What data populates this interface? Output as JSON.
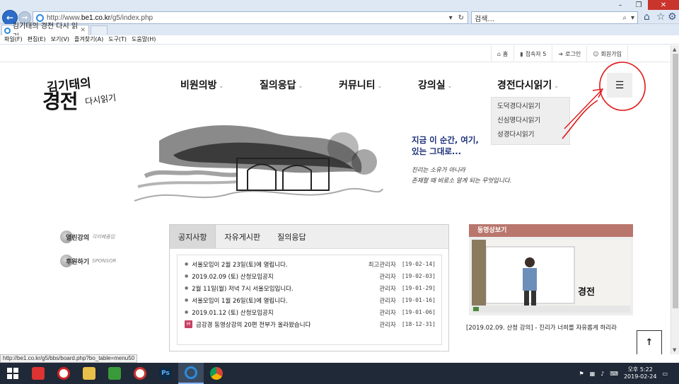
{
  "browser": {
    "url_prefix": "http://www.",
    "url_domain": "be1.co.kr",
    "url_path": "/g5/index.php",
    "search_placeholder": "검색...",
    "tab_title": "김기태의 경전 다시 읽기",
    "menu": [
      "파일(F)",
      "편집(E)",
      "보기(V)",
      "즐겨찾기(A)",
      "도구(T)",
      "도움말(H)"
    ],
    "status_url": "http://be1.co.kr/g5/bbs/board.php?bo_table=menu50"
  },
  "util_links": [
    {
      "icon": "home-icon",
      "glyph": "⌂",
      "label": "홈"
    },
    {
      "icon": "bar-chart-icon",
      "glyph": "▮",
      "label": "접속자 5"
    },
    {
      "icon": "login-icon",
      "glyph": "➜",
      "label": "로그인"
    },
    {
      "icon": "user-plus-icon",
      "glyph": "☺",
      "label": "회원가입"
    }
  ],
  "logo": {
    "line1": "김기태의",
    "line2": "경전",
    "line3": "다시읽기"
  },
  "nav": [
    {
      "label": "비원의방"
    },
    {
      "label": "질의응답"
    },
    {
      "label": "커뮤니티"
    },
    {
      "label": "강의실"
    },
    {
      "label": "경전다시읽기"
    }
  ],
  "dropdown": [
    "도덕경다시읽기",
    "신심명다시읽기",
    "성경다시읽기"
  ],
  "hero": {
    "headline_1": "지금 이 순간, 여기,",
    "headline_2": "있는 그대로...",
    "sub_1": "진리는 소유가 아니라",
    "sub_2": "존재할 때 비로소 알게 되는 무엇입니다."
  },
  "side_links": [
    {
      "label": "열린강의",
      "sub": "각리베줌입"
    },
    {
      "label": "후원하기",
      "sub": "SPONSOR"
    }
  ],
  "board": {
    "tabs": [
      "공지사항",
      "자유게시판",
      "질의응답"
    ],
    "posts": [
      {
        "title": "서울모임이 2월 23일(토)에 열립니다.",
        "author": "최고관리자",
        "date": "[19-02-14]"
      },
      {
        "title": "2019.02.09 (토) 산청모임공지",
        "author": "관리자",
        "date": "[19-02-03]"
      },
      {
        "title": "2월 11일(월) 저녁 7시 서울모임입니다.",
        "author": "관리자",
        "date": "[19-01-29]"
      },
      {
        "title": "서울모임이 1월 26일(토)에 열립니다.",
        "author": "관리자",
        "date": "[19-01-16]"
      },
      {
        "title": "2019.01.12 (토) 산청모임공지",
        "author": "관리자",
        "date": "[19-01-06]"
      },
      {
        "title": "금강경 동영상강의 20편 전부가 올라왔습니다",
        "author": "관리자",
        "date": "[18-12-31]",
        "badge": "H"
      }
    ]
  },
  "video": {
    "heading": "동영상보기",
    "caption": "[2019.02.09. 산청 강의] - 진리가 너희를 자유롭게 하리라"
  },
  "taskbar": {
    "time": "오후 5:22",
    "date": "2019-02-24"
  }
}
